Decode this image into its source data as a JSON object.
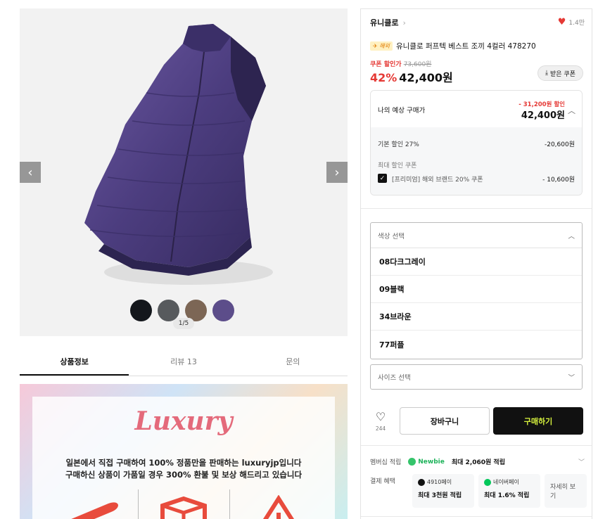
{
  "gallery": {
    "prev_icon": "chevron-left-icon",
    "next_icon": "chevron-right-icon",
    "swatch_colors": [
      "#14171c",
      "#575a5d",
      "#7c6655",
      "#5c4d8a"
    ],
    "counter": "1/5"
  },
  "tabs": [
    {
      "label": "상품정보",
      "active": true
    },
    {
      "label": "리뷰 13",
      "active": false
    },
    {
      "label": "문의",
      "active": false
    }
  ],
  "banner": {
    "logo_text": "Luxury",
    "line1": "일본에서 직접 구매하여 100% 정품만을 판매하는 luxuryjp입니다",
    "line2": "구매하신 상품이 가품일 경우 300% 환불 및 보상 해드리고 있습니다"
  },
  "product": {
    "brand": "유니클로",
    "likes": "1.4만",
    "badge": "해외",
    "title": "유니클로 퍼프텍 베스트 조끼 4컬러 478270",
    "coupon_label": "쿠폰 할인가",
    "original_price": "73,600원",
    "discount_pct": "42%",
    "price": "42,400원",
    "coupon_button": "받은 쿠폰"
  },
  "estimate": {
    "label": "나의 예상 구매가",
    "discount": "- 31,200원 할인",
    "price": "42,400원",
    "base_label": "기본 할인 27%",
    "base_value": "-20,600원",
    "max_coupon_label": "최대 할인 쿠폰",
    "coupon_name": "[프리미엄] 해외 브랜드 20% 쿠폰",
    "coupon_value": "- 10,600원"
  },
  "color_select": {
    "placeholder": "색상 선택",
    "options": [
      "08다크그레이",
      "09블랙",
      "34브라운",
      "77퍼플"
    ]
  },
  "size_select": {
    "placeholder": "사이즈 선택"
  },
  "actions": {
    "wish_count": "244",
    "cart_label": "장바구니",
    "buy_label": "구매하기",
    "buy_text_color": "#d6f23e"
  },
  "membership": {
    "label": "멤버십 적립",
    "tier": "Newbie",
    "text": "최대 2,060원 적립"
  },
  "payment": {
    "label": "결제 혜택",
    "cards": [
      {
        "name": "4910페이",
        "benefit": "최대 3천원 적립"
      },
      {
        "name": "네이버페이",
        "benefit": "최대 1.6% 적립"
      }
    ],
    "more": "자세히 보기"
  }
}
